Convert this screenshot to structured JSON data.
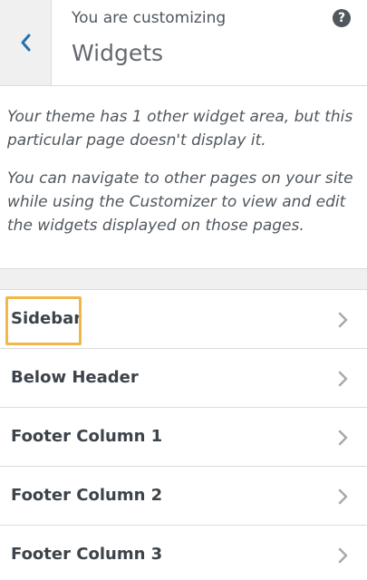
{
  "header": {
    "back_icon": "chevron-left-icon",
    "subtitle": "You are customizing",
    "title": "Widgets",
    "help_icon": "?"
  },
  "notice": {
    "paragraph1": "Your theme has 1 other widget area, but this particular page doesn't display it.",
    "paragraph2": "You can navigate to other pages on your site while using the Customizer to view and edit the widgets displayed on those pages."
  },
  "widget_areas": [
    {
      "label": "Sidebar",
      "highlighted": true
    },
    {
      "label": "Below Header"
    },
    {
      "label": "Footer Column 1"
    },
    {
      "label": "Footer Column 2"
    },
    {
      "label": "Footer Column 3"
    }
  ],
  "colors": {
    "accent": "#2271b1",
    "highlight": "#f0b849",
    "panel_bg": "#f0f0f1"
  }
}
